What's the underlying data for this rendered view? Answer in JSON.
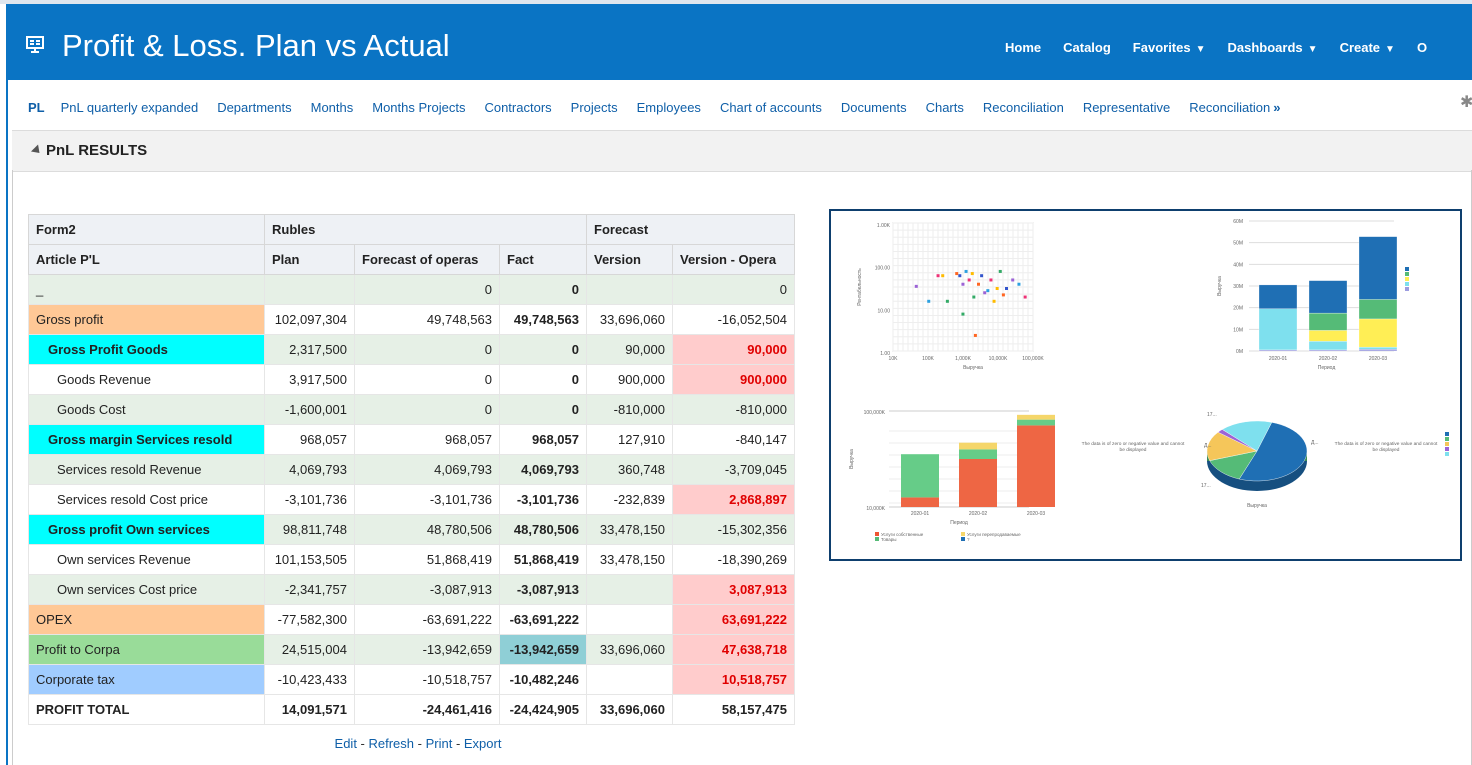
{
  "header": {
    "title": "Profit & Loss. Plan vs Actual",
    "nav": [
      {
        "label": "Home",
        "caret": ""
      },
      {
        "label": "Catalog",
        "caret": ""
      },
      {
        "label": "Favorites",
        "caret": "▼"
      },
      {
        "label": "Dashboards",
        "caret": "▼"
      },
      {
        "label": "Create",
        "caret": "▼"
      },
      {
        "label": "O",
        "caret": ""
      }
    ]
  },
  "tabs": [
    "PL",
    "PnL quarterly expanded",
    "Departments",
    "Months",
    "Months Projects",
    "Contractors",
    "Projects",
    "Employees",
    "Chart of accounts",
    "Documents",
    "Charts",
    "Reconciliation",
    "Representative",
    "Reconciliation"
  ],
  "tabs_more": "»",
  "section": {
    "title": "PnL RESULTS"
  },
  "table": {
    "head1": [
      "Form2",
      "Rubles",
      "Forecast"
    ],
    "head2": [
      "Article P'L",
      "Plan",
      "Forecast of operas",
      "Fact",
      "Version",
      "Version - Opera"
    ],
    "rows": [
      {
        "label": "_",
        "plan": "",
        "fop": "0",
        "fact": "0",
        "ver": "",
        "vmo": "0"
      },
      {
        "label": "Gross profit",
        "plan": "102,097,304",
        "fop": "49,748,563",
        "fact": "49,748,563",
        "ver": "33,696,060",
        "vmo": "-16,052,504"
      },
      {
        "label": "Gross Profit Goods",
        "plan": "2,317,500",
        "fop": "0",
        "fact": "0",
        "ver": "90,000",
        "vmo": "90,000"
      },
      {
        "label": "Goods Revenue",
        "plan": "3,917,500",
        "fop": "0",
        "fact": "0",
        "ver": "900,000",
        "vmo": "900,000"
      },
      {
        "label": "Goods Cost",
        "plan": "-1,600,001",
        "fop": "0",
        "fact": "0",
        "ver": "-810,000",
        "vmo": "-810,000"
      },
      {
        "label": "Gross margin Services resold",
        "plan": "968,057",
        "fop": "968,057",
        "fact": "968,057",
        "ver": "127,910",
        "vmo": "-840,147"
      },
      {
        "label": "Services resold Revenue",
        "plan": "4,069,793",
        "fop": "4,069,793",
        "fact": "4,069,793",
        "ver": "360,748",
        "vmo": "-3,709,045"
      },
      {
        "label": "Services resold Cost price",
        "plan": "-3,101,736",
        "fop": "-3,101,736",
        "fact": "-3,101,736",
        "ver": "-232,839",
        "vmo": "2,868,897"
      },
      {
        "label": "Gross profit Own services",
        "plan": "98,811,748",
        "fop": "48,780,506",
        "fact": "48,780,506",
        "ver": "33,478,150",
        "vmo": "-15,302,356"
      },
      {
        "label": "Own services Revenue",
        "plan": "101,153,505",
        "fop": "51,868,419",
        "fact": "51,868,419",
        "ver": "33,478,150",
        "vmo": "-18,390,269"
      },
      {
        "label": "Own services Cost price",
        "plan": "-2,341,757",
        "fop": "-3,087,913",
        "fact": "-3,087,913",
        "ver": "",
        "vmo": "3,087,913"
      },
      {
        "label": "OPEX",
        "plan": "-77,582,300",
        "fop": "-63,691,222",
        "fact": "-63,691,222",
        "ver": "",
        "vmo": "63,691,222"
      },
      {
        "label": "Profit to Corpa",
        "plan": "24,515,004",
        "fop": "-13,942,659",
        "fact": "-13,942,659",
        "ver": "33,696,060",
        "vmo": "47,638,718"
      },
      {
        "label": "Corporate tax",
        "plan": "-10,423,433",
        "fop": "-10,518,757",
        "fact": "-10,482,246",
        "ver": "",
        "vmo": "10,518,757"
      },
      {
        "label": "PROFIT TOTAL",
        "plan": "14,091,571",
        "fop": "-24,461,416",
        "fact": "-24,424,905",
        "ver": "33,696,060",
        "vmo": "58,157,475"
      }
    ]
  },
  "actions": {
    "edit": "Edit",
    "refresh": "Refresh",
    "print": "Print",
    "export": "Export",
    "sep": " - "
  },
  "charts_panel": {
    "scatter": {
      "type": "scatter",
      "ylabel": "Рентабельность",
      "xlabel": "Выручка",
      "xticks": [
        "10K",
        "100K",
        "1,000K",
        "10,000K",
        "100,000K"
      ],
      "yticks": [
        "1.00K",
        "100.00",
        "10.00",
        "1.00"
      ],
      "points": [
        [
          0.7,
          1.55
        ],
        [
          1.1,
          1.2
        ],
        [
          1.4,
          1.8
        ],
        [
          1.55,
          1.8
        ],
        [
          1.7,
          1.2
        ],
        [
          2.0,
          1.85
        ],
        [
          2.1,
          1.8
        ],
        [
          2.2,
          1.6
        ],
        [
          2.3,
          1.9
        ],
        [
          2.4,
          1.7
        ],
        [
          2.5,
          1.85
        ],
        [
          2.55,
          1.3
        ],
        [
          2.7,
          1.6
        ],
        [
          2.8,
          1.8
        ],
        [
          2.9,
          1.4
        ],
        [
          3.0,
          1.45
        ],
        [
          3.1,
          1.7
        ],
        [
          3.3,
          1.5
        ],
        [
          3.4,
          1.9
        ],
        [
          3.5,
          1.35
        ],
        [
          3.6,
          1.5
        ],
        [
          3.8,
          1.7
        ],
        [
          4.0,
          1.6
        ],
        [
          4.2,
          1.3
        ],
        [
          3.2,
          1.2
        ],
        [
          2.2,
          0.9
        ],
        [
          2.6,
          0.4
        ]
      ],
      "colors": [
        "#9c63d6",
        "#2ca0e0",
        "#ee3377",
        "#ffbb00",
        "#33aa66",
        "#ff6622",
        "#3355cc"
      ]
    },
    "stacked_bar": {
      "type": "bar",
      "categories": [
        "2020-01",
        "2020-02",
        "2020-03"
      ],
      "ylabel": "Выручка",
      "xlabel": "Период",
      "yticks": [
        "60M",
        "50M",
        "40M",
        "30M",
        "20M",
        "10M",
        "0M"
      ],
      "series": [
        {
          "values": [
            0.5,
            0.5,
            0.8
          ],
          "color": "#9c9ce0"
        },
        {
          "values": [
            19,
            4,
            1
          ],
          "color": "#7ee0ee"
        },
        {
          "values": [
            0,
            5,
            13
          ],
          "color": "#ffee55"
        },
        {
          "values": [
            0,
            8,
            9
          ],
          "color": "#55bb77"
        },
        {
          "values": [
            11,
            15,
            29
          ],
          "color": "#1f6fb4"
        }
      ],
      "ylim": [
        0,
        60
      ]
    },
    "small_bar": {
      "type": "bar",
      "categories": [
        "2020-01",
        "2020-02",
        "2020-03"
      ],
      "ylabel": "Выручка",
      "xlabel": "Период",
      "yticks": [
        "100,000K",
        "10,000K"
      ],
      "series": [
        {
          "values": [
            0.1,
            0.5,
            0.85
          ],
          "color": "#ee6644"
        },
        {
          "values": [
            0.45,
            0.1,
            0.06
          ],
          "color": "#66cc88"
        },
        {
          "values": [
            0,
            0.07,
            0.05
          ],
          "color": "#f5d66a"
        }
      ],
      "legend": [
        "Услуги собственные",
        "Услуги перепродаваемые",
        "Товары",
        "?"
      ],
      "legend_colors": [
        "#ee5533",
        "#f5d66a",
        "#55bb77",
        "#1f6fb4"
      ]
    },
    "pie": {
      "type": "pie",
      "xlabel": "Выручка",
      "note": "The data is of zero or negative value and cannot be displayed",
      "slices": [
        {
          "value": 51,
          "color": "#1f6fb4"
        },
        {
          "value": 14,
          "color": "#55bb77"
        },
        {
          "value": 16,
          "color": "#f5c65a"
        },
        {
          "value": 2,
          "color": "#9c63d6"
        },
        {
          "value": 17,
          "color": "#7ee0ee"
        }
      ],
      "labels": [
        "17...",
        "Д...",
        "Д...",
        "17..."
      ]
    }
  },
  "colors": {
    "header": "#0a74c4",
    "link": "#0f5fa8",
    "orange": "#ffc896",
    "cyan": "#00ffff",
    "green": "#99dc99",
    "blue": "#a0ccff",
    "pink": "#ffcccc"
  }
}
